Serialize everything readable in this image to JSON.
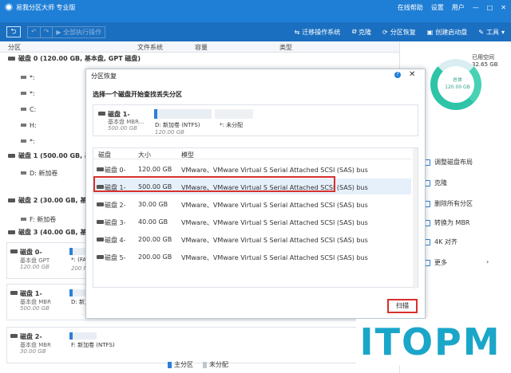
{
  "app": {
    "title": "易我分区大师 专业版",
    "tb_online": "在线帮助",
    "tb_settings": "设置",
    "tb_user": "用户"
  },
  "toolbar": {
    "undo_hint": "↶",
    "redo_hint": "↷",
    "execute_label": "▶ 全部执行操作",
    "migrate": "迁移操作系统",
    "clone": "克隆",
    "recover": "分区恢复",
    "bootable": "创建启动盘",
    "tools": "工具"
  },
  "columns": {
    "partition": "分区",
    "filesystem": "文件系统",
    "capacity": "容量",
    "type": "类型"
  },
  "tree": [
    {
      "kind": "disk",
      "label": "磁盘 0 (120.00 GB, 基本盘, GPT 磁盘)"
    },
    {
      "kind": "part",
      "label": "*:"
    },
    {
      "kind": "part",
      "label": "*:"
    },
    {
      "kind": "part",
      "label": "C:"
    },
    {
      "kind": "part",
      "label": "H:"
    },
    {
      "kind": "part",
      "label": "*:"
    },
    {
      "kind": "disk",
      "label": "磁盘 1 (500.00 GB, 基本"
    },
    {
      "kind": "part",
      "label": "D: 新加卷"
    },
    {
      "kind": "disk",
      "label": "磁盘 2 (30.00 GB, 基本"
    },
    {
      "kind": "part",
      "label": "F: 新加卷"
    },
    {
      "kind": "disk",
      "label": "磁盘 3 (40.00 GB, 基本盘"
    }
  ],
  "cards": [
    {
      "name": "磁盘 0-",
      "sub": "基本盘 GPT",
      "size": "120.00 GB",
      "label": "*: (FAT32",
      "lsize": "200 MB"
    },
    {
      "name": "磁盘 1-",
      "sub": "基本盘 MBR",
      "size": "500.00 GB",
      "label": "D: 新加卷",
      "lsize": ""
    },
    {
      "name": "磁盘 2-",
      "sub": "基本盘 MBR",
      "size": "30.00 GB",
      "label": "F: 新加卷 (NTFS)",
      "lsize": ""
    }
  ],
  "legend": {
    "primary": "主分区",
    "unalloc": "未分配",
    "primary_color": "#2c7fd8",
    "unalloc_color": "#bfc6ce"
  },
  "rightpanel": {
    "used": "已用空间",
    "used_value": "32.65 GB",
    "total": "总体",
    "total_value": "120.00 GB",
    "actions": [
      "调整磁盘布局",
      "克隆",
      "删除所有分区",
      "转换为 MBR",
      "4K 对齐",
      "更多"
    ]
  },
  "dialog": {
    "title": "分区恢复",
    "help": "?",
    "close": "✕",
    "instruction": "选择一个磁盘开始查找丢失分区",
    "preview": {
      "name": "磁盘 1-",
      "sub": "基本盘 MBR...",
      "size": "500.00 GB",
      "p1": "D: 新加卷 (NTFS)",
      "p1size": "120.00 GB",
      "p2": "*: 未分配"
    },
    "headers": {
      "disk": "磁盘",
      "size": "大小",
      "model": "模型"
    },
    "rows": [
      {
        "disk": "磁盘 0-",
        "size": "120.00 GB",
        "model": "VMware、VMware Virtual S Serial Attached SCSI (SAS) bus"
      },
      {
        "disk": "磁盘 1-",
        "size": "500.00 GB",
        "model": "VMware、VMware Virtual S Serial Attached SCSI (SAS) bus"
      },
      {
        "disk": "磁盘 2-",
        "size": "30.00 GB",
        "model": "VMware、VMware Virtual S Serial Attached SCSI (SAS) bus"
      },
      {
        "disk": "磁盘 3-",
        "size": "40.00 GB",
        "model": "VMware、VMware Virtual S Serial Attached SCSI (SAS) bus"
      },
      {
        "disk": "磁盘 4-",
        "size": "200.00 GB",
        "model": "VMware、VMware Virtual S Serial Attached SCSI (SAS) bus"
      },
      {
        "disk": "磁盘 5-",
        "size": "200.00 GB",
        "model": "VMware、VMware Virtual S Serial Attached SCSI (SAS) bus"
      }
    ],
    "selected_index": 1,
    "scan_label": "扫描"
  },
  "watermark": "ITOPM"
}
